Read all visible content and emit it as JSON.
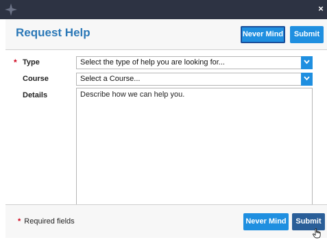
{
  "window": {
    "close_glyph": "×"
  },
  "dialog": {
    "title": "Request Help",
    "header_buttons": {
      "cancel": "Never Mind",
      "submit": "Submit"
    },
    "form": {
      "type": {
        "label": "Type",
        "required": true,
        "value": "Select the type of help you are looking for..."
      },
      "course": {
        "label": "Course",
        "required": false,
        "value": "Select a Course..."
      },
      "details": {
        "label": "Details",
        "required": false,
        "placeholder": "Describe how we can help you."
      }
    },
    "footer": {
      "required_marker": "*",
      "required_text": "Required fields",
      "cancel": "Never Mind",
      "submit": "Submit"
    }
  },
  "colors": {
    "accent": "#1f8fe0",
    "title": "#2b78b7",
    "required": "#d0021b",
    "titlebar": "#2d3343"
  },
  "icons": [
    "app-logo-icon",
    "close-icon",
    "chevron-down-icon",
    "hand-cursor-icon"
  ]
}
